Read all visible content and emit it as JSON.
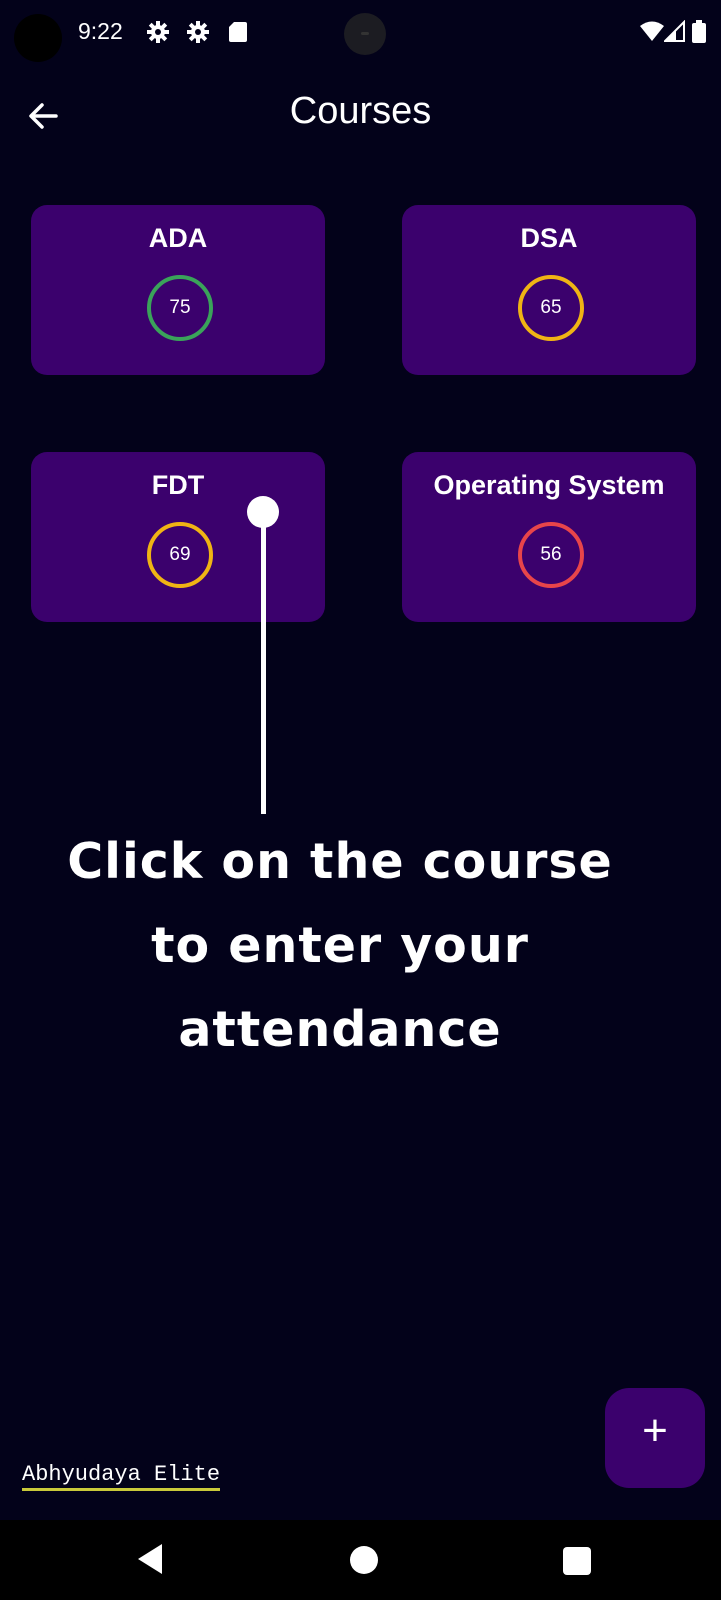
{
  "status_bar": {
    "time": "9:22",
    "left_icons": [
      "settings-icon",
      "settings-icon",
      "sd-card-icon"
    ],
    "right_icons": [
      "wifi-icon",
      "signal-icon",
      "battery-icon"
    ]
  },
  "app_bar": {
    "title": "Courses",
    "back_icon": "arrow-left-icon"
  },
  "courses": [
    {
      "name": "ADA",
      "attendance": "75",
      "ring_color": "#3aa35a"
    },
    {
      "name": "DSA",
      "attendance": "65",
      "ring_color": "#f0b414"
    },
    {
      "name": "FDT",
      "attendance": "69",
      "ring_color": "#f0b414"
    },
    {
      "name": "Operating System",
      "attendance": "56",
      "ring_color": "#e8454a"
    }
  ],
  "hint": {
    "line1": "Click on the course",
    "line2": "to enter your",
    "line3": "attendance"
  },
  "fab": {
    "label": "+"
  },
  "footer": {
    "brand": "Abhyudaya Elite"
  },
  "colors": {
    "background": "#03021a",
    "card": "#3b016d",
    "accent_underline": "#c9c93a"
  }
}
